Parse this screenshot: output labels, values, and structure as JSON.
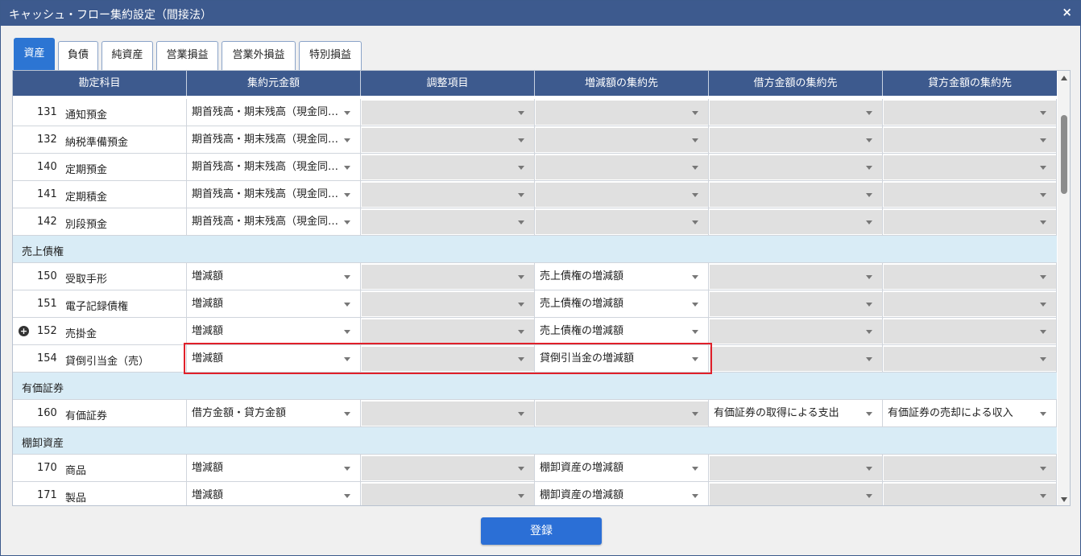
{
  "window": {
    "title": "キャッシュ・フロー集約設定（間接法）",
    "close_icon": "×"
  },
  "tabs": [
    {
      "label": "資産",
      "active": true
    },
    {
      "label": "負債",
      "active": false
    },
    {
      "label": "純資産",
      "active": false
    },
    {
      "label": "営業損益",
      "active": false
    },
    {
      "label": "営業外損益",
      "active": false
    },
    {
      "label": "特別損益",
      "active": false
    }
  ],
  "table": {
    "headers": [
      "勘定科目",
      "集約元金額",
      "調整項目",
      "増減額の集約先",
      "借方金額の集約先",
      "貸方金額の集約先"
    ],
    "rows": [
      {
        "type": "account",
        "code": "131",
        "name": "通知預金",
        "c1": "期首残高・期末残高（現金同…",
        "c1_on": true,
        "c2": "",
        "c2_on": false,
        "c3": "",
        "c3_on": false,
        "c4": "",
        "c4_on": false,
        "c5": "",
        "c5_on": false
      },
      {
        "type": "account",
        "code": "132",
        "name": "納税準備預金",
        "c1": "期首残高・期末残高（現金同…",
        "c1_on": true,
        "c2": "",
        "c2_on": false,
        "c3": "",
        "c3_on": false,
        "c4": "",
        "c4_on": false,
        "c5": "",
        "c5_on": false
      },
      {
        "type": "account",
        "code": "140",
        "name": "定期預金",
        "c1": "期首残高・期末残高（現金同…",
        "c1_on": true,
        "c2": "",
        "c2_on": false,
        "c3": "",
        "c3_on": false,
        "c4": "",
        "c4_on": false,
        "c5": "",
        "c5_on": false
      },
      {
        "type": "account",
        "code": "141",
        "name": "定期積金",
        "c1": "期首残高・期末残高（現金同…",
        "c1_on": true,
        "c2": "",
        "c2_on": false,
        "c3": "",
        "c3_on": false,
        "c4": "",
        "c4_on": false,
        "c5": "",
        "c5_on": false
      },
      {
        "type": "account",
        "code": "142",
        "name": "別段預金",
        "c1": "期首残高・期末残高（現金同…",
        "c1_on": true,
        "c2": "",
        "c2_on": false,
        "c3": "",
        "c3_on": false,
        "c4": "",
        "c4_on": false,
        "c5": "",
        "c5_on": false
      },
      {
        "type": "group",
        "label": "売上債権"
      },
      {
        "type": "account",
        "code": "150",
        "name": "受取手形",
        "c1": "増減額",
        "c1_on": true,
        "c2": "",
        "c2_on": false,
        "c3": "売上債権の増減額",
        "c3_on": true,
        "c4": "",
        "c4_on": false,
        "c5": "",
        "c5_on": false
      },
      {
        "type": "account",
        "code": "151",
        "name": "電子記録債権",
        "c1": "増減額",
        "c1_on": true,
        "c2": "",
        "c2_on": false,
        "c3": "売上債権の増減額",
        "c3_on": true,
        "c4": "",
        "c4_on": false,
        "c5": "",
        "c5_on": false
      },
      {
        "type": "account",
        "code": "152",
        "name": "売掛金",
        "expand": true,
        "c1": "増減額",
        "c1_on": true,
        "c2": "",
        "c2_on": false,
        "c3": "売上債権の増減額",
        "c3_on": true,
        "c4": "",
        "c4_on": false,
        "c5": "",
        "c5_on": false
      },
      {
        "type": "account",
        "code": "154",
        "name": "貸倒引当金（売）",
        "c1": "増減額",
        "c1_on": true,
        "c2": "",
        "c2_on": false,
        "c3": "貸倒引当金の増減額",
        "c3_on": true,
        "c4": "",
        "c4_on": false,
        "c5": "",
        "c5_on": false
      },
      {
        "type": "group",
        "label": "有価証券"
      },
      {
        "type": "account",
        "code": "160",
        "name": "有価証券",
        "c1": "借方金額・貸方金額",
        "c1_on": true,
        "c2": "",
        "c2_on": false,
        "c3": "",
        "c3_on": false,
        "c4": "有価証券の取得による支出",
        "c4_on": true,
        "c5": "有価証券の売却による収入",
        "c5_on": true
      },
      {
        "type": "group",
        "label": "棚卸資産"
      },
      {
        "type": "account",
        "code": "170",
        "name": "商品",
        "c1": "増減額",
        "c1_on": true,
        "c2": "",
        "c2_on": false,
        "c3": "棚卸資産の増減額",
        "c3_on": true,
        "c4": "",
        "c4_on": false,
        "c5": "",
        "c5_on": false
      },
      {
        "type": "account",
        "code": "171",
        "name": "製品",
        "c1": "増減額",
        "c1_on": true,
        "c2": "",
        "c2_on": false,
        "c3": "棚卸資産の増減額",
        "c3_on": true,
        "c4": "",
        "c4_on": false,
        "c5": "",
        "c5_on": false
      }
    ]
  },
  "footer": {
    "submit_label": "登録"
  },
  "colors": {
    "titlebar": "#3d5a8e",
    "active_tab": "#2c75d3",
    "group_row": "#d9ecf6",
    "highlight": "#e0202a",
    "button": "#2b6fd6"
  }
}
